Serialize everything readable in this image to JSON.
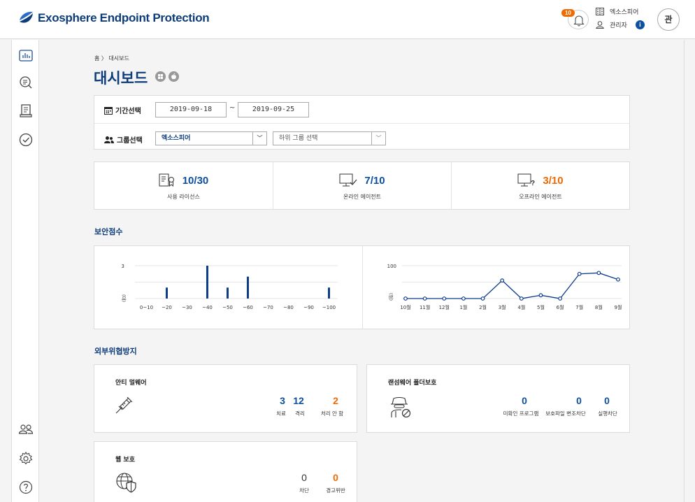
{
  "header": {
    "brand": "Exosphere Endpoint Protection",
    "notification_count": "10",
    "organization": "엑소스피어",
    "user": "관리자",
    "user_info_icon": "i",
    "avatar": "관"
  },
  "sidebar": {
    "items": [
      {
        "name": "dashboard",
        "icon": "bar-chart-icon"
      },
      {
        "name": "inspection",
        "icon": "search-icon"
      },
      {
        "name": "report",
        "icon": "document-icon"
      },
      {
        "name": "check",
        "icon": "check-circle-icon"
      },
      {
        "name": "users",
        "icon": "users-icon"
      },
      {
        "name": "settings",
        "icon": "gear-icon"
      },
      {
        "name": "help",
        "icon": "help-icon"
      }
    ]
  },
  "breadcrumb": "홈 〉 대시보드",
  "page_title": "대시보드",
  "filters": {
    "period_label": "기간선택",
    "start_date": "2019-09-18",
    "separator": "~",
    "end_date": "2019-09-25",
    "group_label": "그룹선택",
    "group_value": "엑소스피어",
    "subgroup_placeholder": "하위 그룹 선택"
  },
  "stats": [
    {
      "value": "10/30",
      "label": "사용 라이선스",
      "icon": "license-icon",
      "color": "#0d4fa0"
    },
    {
      "value": "7/10",
      "label": "온라인 에이전트",
      "icon": "online-agent-icon",
      "color": "#0d4fa0"
    },
    {
      "value": "3/10",
      "label": "오프라인 에이전트",
      "icon": "offline-agent-icon",
      "color": "#f06a00"
    }
  ],
  "security_score": {
    "title": "보안점수"
  },
  "chart_data": [
    {
      "type": "bar",
      "categories": [
        "0~10",
        "~20",
        "~30",
        "~40",
        "~50",
        "~60",
        "~70",
        "~80",
        "~90",
        "~100"
      ],
      "values": [
        0,
        1,
        0,
        3,
        1,
        2,
        0,
        0,
        0,
        1
      ],
      "ylabel": "(대)",
      "ylim": [
        0,
        3
      ],
      "yticks": [
        "3"
      ],
      "color": "#0d3c8c"
    },
    {
      "type": "line",
      "categories": [
        "10월",
        "11월",
        "12월",
        "1월",
        "2월",
        "3월",
        "4월",
        "5월",
        "6월",
        "7월",
        "8월",
        "9월"
      ],
      "values": [
        0,
        0,
        0,
        0,
        0,
        55,
        0,
        10,
        0,
        75,
        78,
        58
      ],
      "ylabel": "(점)",
      "ylim": [
        0,
        100
      ],
      "yticks": [
        "100"
      ],
      "color": "#0d3c8c"
    }
  ],
  "external_threat": {
    "title": "외부위협방지",
    "anti_malware": {
      "title": "안티 멀웨어",
      "icon": "syringe-icon",
      "treated": "3",
      "treated_label": "치료",
      "quarantined": "12",
      "quarantined_label": "격리",
      "unprocessed": "2",
      "unprocessed_label": "처리 안 함"
    },
    "ransomware": {
      "title": "랜섬웨어 폴더보호",
      "icon": "hacker-icon",
      "unverified": "0",
      "unverified_label": "미확인 프로그램",
      "tamper_blocked": "0",
      "tamper_blocked_label": "보호파일 변조차단",
      "exec_blocked": "0",
      "exec_blocked_label": "실행차단"
    },
    "web_protection": {
      "title": "웹 보호",
      "icon": "globe-shield-icon",
      "blocked": "0",
      "blocked_label": "차단",
      "warned": "0",
      "warned_label": "경고위반"
    }
  }
}
